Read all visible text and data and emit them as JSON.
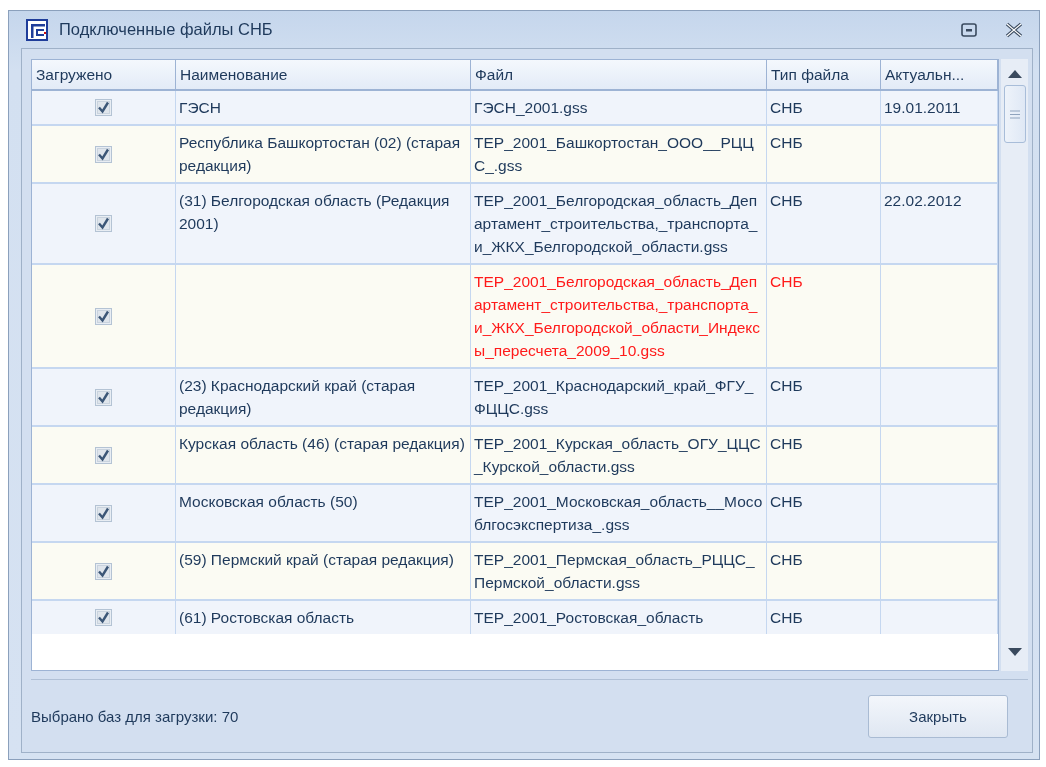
{
  "window": {
    "title": "Подключенные файлы СНБ"
  },
  "table": {
    "columns": [
      "Загружено",
      "Наименование",
      "Файл",
      "Тип файла",
      "Актуальн..."
    ],
    "rows": [
      {
        "checked": true,
        "name": "ГЭСН",
        "file": "ГЭСН_2001.gss",
        "type": "СНБ",
        "date": "19.01.2011",
        "highlighted": false
      },
      {
        "checked": true,
        "name": "Республика Башкортостан (02) (старая редакция)",
        "file": "ТЕР_2001_Башкортостан_ООО__РЦЦС_.gss",
        "type": "СНБ",
        "highlighted": false
      },
      {
        "checked": true,
        "name": "(31) Белгородская область (Редакция 2001)",
        "file": "ТЕР_2001_Белгородская_область_Департамент_строительства,_транспорта_и_ЖКХ_Белгородской_области.gss",
        "type": "СНБ",
        "date": "22.02.2012",
        "highlighted": false
      },
      {
        "checked": true,
        "file": "ТЕР_2001_Белгородская_область_Департамент_строительства,_транспорта_и_ЖКХ_Белгородской_области_Индексы_пересчета_2009_10.gss",
        "type": "СНБ",
        "highlighted": true
      },
      {
        "checked": true,
        "name": "(23) Краснодарский край (старая редакция)",
        "file": "ТЕР_2001_Краснодарский_край_ФГУ_ФЦЦС.gss",
        "type": "СНБ",
        "highlighted": false
      },
      {
        "checked": true,
        "name": "Курская область (46)  (старая редакция)",
        "file": "ТЕР_2001_Курская_область_ОГУ_ЦЦС_Курской_области.gss",
        "type": "СНБ",
        "highlighted": false
      },
      {
        "checked": true,
        "name": "Московская область (50)",
        "file": "ТЕР_2001_Московская_область__Мособлгосэкспертиза_.gss",
        "type": "СНБ",
        "highlighted": false
      },
      {
        "checked": true,
        "name": "(59) Пермский край  (старая редакция)",
        "file": "ТЕР_2001_Пермская_область_РЦЦС_Пермской_области.gss",
        "type": "СНБ",
        "highlighted": false
      },
      {
        "checked": true,
        "name": "(61) Ростовская область",
        "file": "ТЕР_2001_Ростовская_область",
        "type": "СНБ",
        "highlighted": false
      }
    ]
  },
  "status": "Выбрано баз для загрузки: 70",
  "buttons": [
    "Закрыть"
  ]
}
